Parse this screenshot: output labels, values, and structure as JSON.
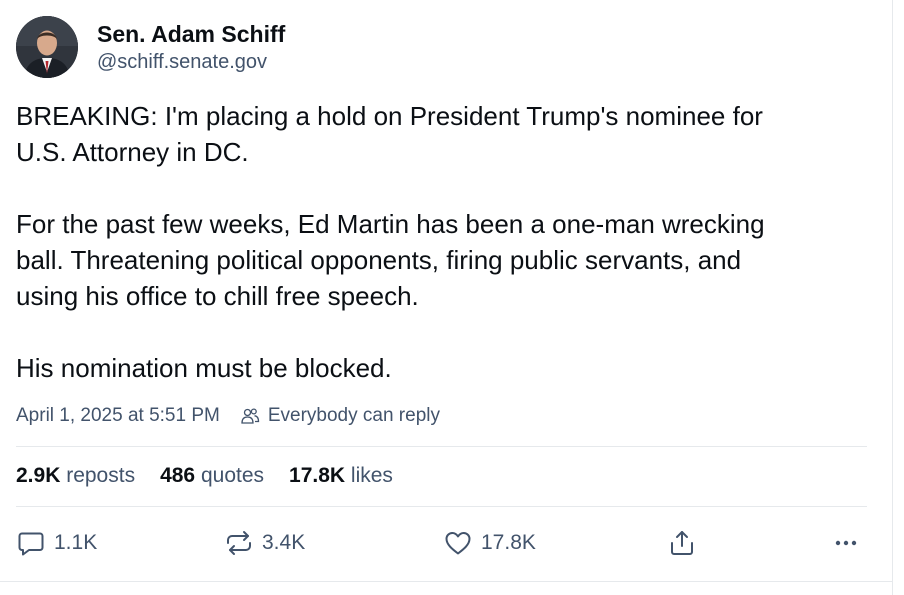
{
  "author": {
    "display_name": "Sen. Adam Schiff",
    "handle": "@schiff.senate.gov"
  },
  "post": {
    "paragraphs": [
      [
        "BREAKING: I'm placing a hold on President Trump's nominee for",
        "U.S. Attorney in DC."
      ],
      [
        "For the past few weeks, Ed Martin has been a one-man wrecking",
        "ball. Threatening political opponents, firing public servants, and",
        "using his office to chill free speech."
      ],
      [
        "His nomination must be blocked."
      ]
    ]
  },
  "meta": {
    "timestamp": "April 1, 2025 at 5:51 PM",
    "reply_setting": "Everybody can reply"
  },
  "stats": {
    "reposts_count": "2.9K",
    "reposts_label": "reposts",
    "quotes_count": "486",
    "quotes_label": "quotes",
    "likes_count": "17.8K",
    "likes_label": "likes"
  },
  "actions": {
    "reply_count": "1.1K",
    "repost_count": "3.4K",
    "like_count": "17.8K"
  },
  "icons": {
    "reply": "speech-bubble-icon",
    "repost": "repost-arrows-icon",
    "like": "heart-icon",
    "share": "share-upload-icon",
    "more": "more-dots-icon",
    "people": "people-icon"
  },
  "colors": {
    "text_primary": "#0b0f14",
    "text_secondary": "#42536b",
    "divider": "#e6e9ec"
  }
}
